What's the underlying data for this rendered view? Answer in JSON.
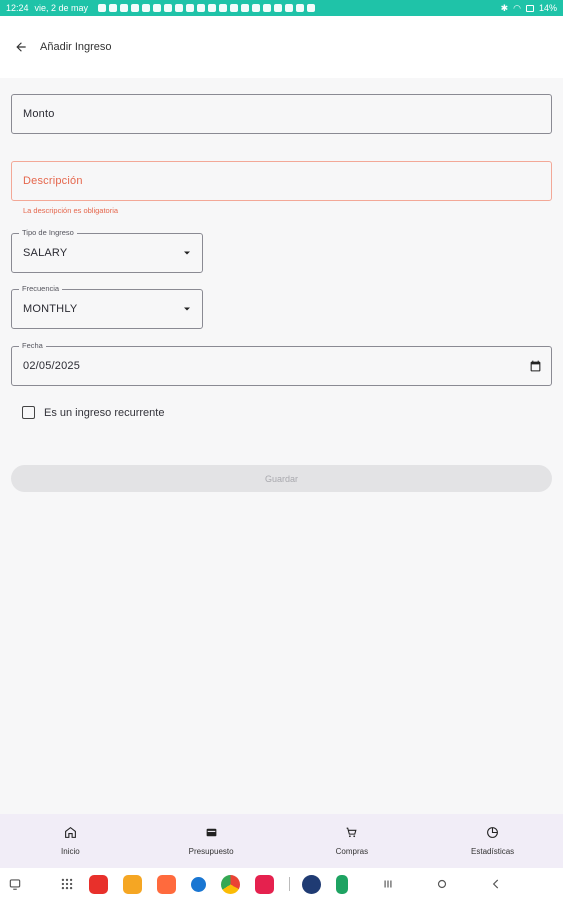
{
  "status_bar": {
    "time": "12:24",
    "date": "vie, 2 de may",
    "battery": "14%"
  },
  "app_bar": {
    "title": "Añadir Ingreso"
  },
  "form": {
    "monto": {
      "label": "Monto"
    },
    "descripcion": {
      "label": "Descripción",
      "error": "La descripción es obligatoria"
    },
    "tipo": {
      "label": "Tipo de Ingreso",
      "value": "SALARY"
    },
    "frecuencia": {
      "label": "Frecuencia",
      "value": "MONTHLY"
    },
    "fecha": {
      "label": "Fecha",
      "value": "02/05/2025"
    },
    "recurrente": {
      "label": "Es un ingreso recurrente",
      "checked": false
    },
    "save_label": "Guardar"
  },
  "bottom_nav": {
    "items": [
      {
        "label": "Inicio",
        "icon": "home-icon"
      },
      {
        "label": "Presupuesto",
        "icon": "wallet-icon"
      },
      {
        "label": "Compras",
        "icon": "cart-icon"
      },
      {
        "label": "Estadísticas",
        "icon": "chart-icon"
      }
    ]
  },
  "colors": {
    "status_bar": "#1fc3a8",
    "error": "#e5674d",
    "nav_bg": "#f1edf7"
  }
}
